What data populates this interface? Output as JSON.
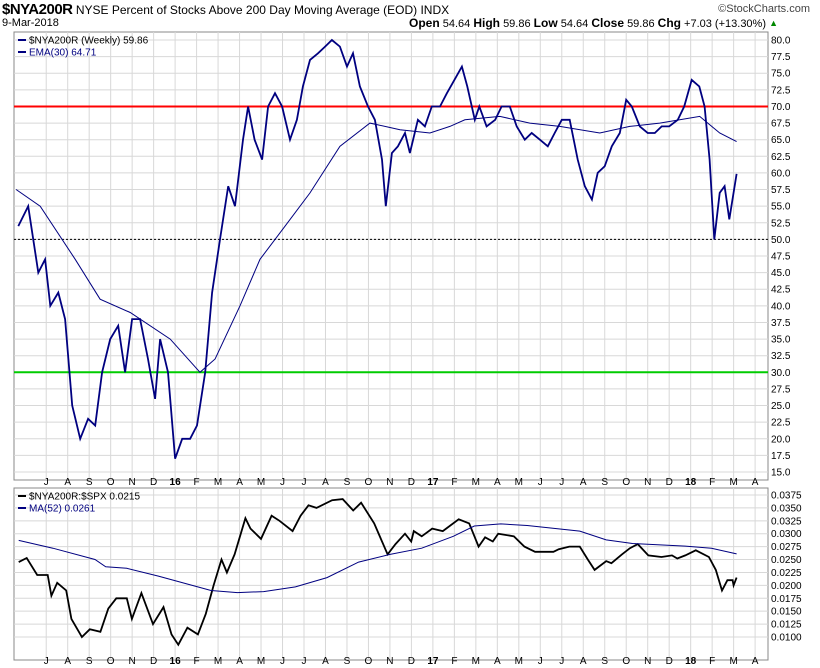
{
  "header": {
    "symbol": "$NYA200R",
    "description": "NYSE Percent of Stocks Above 200 Day Moving Average (EOD)",
    "exchange": "INDX",
    "brand": "©StockCharts.com",
    "date": "9-Mar-2018",
    "open_label": "Open",
    "open": "54.64",
    "high_label": "High",
    "high": "59.86",
    "low_label": "Low",
    "low": "54.64",
    "close_label": "Close",
    "close": "59.86",
    "chg_label": "Chg",
    "chg": "+7.03 (+13.30%)",
    "chg_icon": "up-triangle-icon"
  },
  "colors": {
    "price": "#000080",
    "ema": "#000080",
    "ratio": "#000000",
    "ma": "#000080",
    "red_line": "#ff0000",
    "green_line": "#00cc00",
    "grid": "#d8d8d8"
  },
  "chart_data": [
    {
      "type": "line",
      "title": "$NYA200R NYSE Percent of Stocks Above 200 Day Moving Average (EOD)",
      "x_unit": "months since Jun 2015",
      "xlim": [
        -0.5,
        34.6
      ],
      "ylim": [
        15,
        80
      ],
      "yticks": [
        15.0,
        17.5,
        20.0,
        22.5,
        25.0,
        27.5,
        30.0,
        32.5,
        35.0,
        37.5,
        40.0,
        42.5,
        45.0,
        47.5,
        50.0,
        52.5,
        55.0,
        57.5,
        60.0,
        62.5,
        65.0,
        67.5,
        70.0,
        72.5,
        75.0,
        77.5,
        80.0
      ],
      "xtick_labels": [
        "J",
        "A",
        "S",
        "O",
        "N",
        "D",
        "16",
        "F",
        "M",
        "A",
        "M",
        "J",
        "J",
        "A",
        "S",
        "O",
        "N",
        "D",
        "17",
        "F",
        "M",
        "A",
        "M",
        "J",
        "J",
        "A",
        "S",
        "O",
        "N",
        "D",
        "18",
        "F",
        "M",
        "A"
      ],
      "grid": true,
      "legend": "top-left",
      "hlines": [
        {
          "value": 70,
          "color": "#ff0000"
        },
        {
          "value": 30,
          "color": "#00cc00"
        },
        {
          "value": 50,
          "style": "dotted"
        }
      ],
      "series": [
        {
          "name": "$NYA200R (Weekly) 59.86",
          "key": "price",
          "x": [
            -0.3,
            0.16,
            0.63,
            0.95,
            1.19,
            1.56,
            1.88,
            2.21,
            2.58,
            2.95,
            3.28,
            3.6,
            3.98,
            4.35,
            4.67,
            5.0,
            5.37,
            5.74,
            6.07,
            6.3,
            6.67,
            7.0,
            7.33,
            7.7,
            8.02,
            8.4,
            8.72,
            9.09,
            9.47,
            9.79,
            10.16,
            10.4,
            10.7,
            11.05,
            11.33,
            11.65,
            11.98,
            12.35,
            12.67,
            12.95,
            13.28,
            13.65,
            13.98,
            14.3,
            14.67,
            15.0,
            15.28,
            15.6,
            15.98,
            16.3,
            16.63,
            16.81,
            17.09,
            17.37,
            17.7,
            17.93,
            18.3,
            18.63,
            18.95,
            19.33,
            19.65,
            20.0,
            20.35,
            20.6,
            20.95,
            21.16,
            21.5,
            21.9,
            22.2,
            22.58,
            22.9,
            23.28,
            23.6,
            23.98,
            24.35,
            24.67,
            25.0,
            25.37,
            25.74,
            26.07,
            26.4,
            26.67,
            27.0,
            27.33,
            27.7,
            28.0,
            28.26,
            28.63,
            29.0,
            29.33,
            29.65,
            30.0,
            30.4,
            30.7,
            31.05,
            31.4,
            31.65,
            31.88,
            32.1,
            32.35,
            32.58,
            32.8,
            33.14
          ],
          "y": [
            52,
            55,
            45,
            47,
            40,
            42,
            38,
            25,
            20,
            23,
            22,
            30,
            35,
            37,
            30,
            38,
            38,
            32,
            26,
            35,
            30,
            17,
            20,
            20,
            22,
            30,
            42,
            50,
            58,
            55,
            65,
            70,
            65,
            62,
            70,
            72,
            70,
            65,
            68,
            73,
            77,
            78,
            79,
            80,
            79,
            76,
            78,
            73,
            70,
            68,
            62,
            55,
            63,
            64,
            66,
            63,
            68,
            67,
            70,
            70,
            72,
            74,
            76,
            73,
            68,
            70,
            67,
            68,
            70,
            70,
            67,
            65,
            66,
            65,
            64,
            66,
            68,
            68,
            62,
            58,
            56,
            60,
            61,
            64,
            66,
            71,
            70,
            67,
            66,
            66,
            67,
            67,
            68,
            70,
            74,
            73,
            70,
            62,
            50,
            57,
            58,
            53,
            59.86
          ]
        },
        {
          "name": "EMA(30) 64.71",
          "key": "ema",
          "x": [
            -0.4,
            0.72,
            2.35,
            3.51,
            4.91,
            6.77,
            8.16,
            8.86,
            10.02,
            10.95,
            12.12,
            13.28,
            14.67,
            16.07,
            17.47,
            18.86,
            19.79,
            20.49,
            22.12,
            23.51,
            24.91,
            26.77,
            28.16,
            29.56,
            31.42,
            32.35,
            33.14
          ],
          "y": [
            57.5,
            55,
            47,
            41,
            39,
            35,
            30,
            32,
            40,
            47,
            52,
            57,
            64,
            67.5,
            66.5,
            66,
            67,
            68,
            68.5,
            67.5,
            67,
            66,
            67,
            67.5,
            68.5,
            66,
            64.71
          ]
        }
      ]
    },
    {
      "type": "line",
      "title": "$NYA200R:$SPX",
      "x_unit": "months since Jun 2015",
      "xlim": [
        -0.5,
        34.6
      ],
      "ylim": [
        0.0085,
        0.038
      ],
      "yticks": [
        "0.0100",
        "0.0125",
        "0.0150",
        "0.0175",
        "0.0200",
        "0.0225",
        "0.0250",
        "0.0275",
        "0.0300",
        "0.0325",
        "0.0350",
        "0.0375"
      ],
      "grid": true,
      "legend": "top-left",
      "series": [
        {
          "name": "$NYA200R:$SPX 0.0215",
          "key": "ratio",
          "x": [
            -0.28,
            0.09,
            0.58,
            1.07,
            1.24,
            1.51,
            1.93,
            2.17,
            2.66,
            3.03,
            3.52,
            3.89,
            4.26,
            4.75,
            4.99,
            5.43,
            5.97,
            6.46,
            6.83,
            7.15,
            7.57,
            8.06,
            8.43,
            8.79,
            9.16,
            9.41,
            9.77,
            10.27,
            10.51,
            11.0,
            11.49,
            11.86,
            12.47,
            12.84,
            13.21,
            13.58,
            14.31,
            14.8,
            15.29,
            15.66,
            16.27,
            16.89,
            17.26,
            17.7,
            17.99,
            18.11,
            18.48,
            18.97,
            19.46,
            20.2,
            20.69,
            21.13,
            21.43,
            21.79,
            22.04,
            22.77,
            23.26,
            23.76,
            24.61,
            24.86,
            25.35,
            25.84,
            26.21,
            26.53,
            27.07,
            27.31,
            27.8,
            28.17,
            28.54,
            29.03,
            29.64,
            30.13,
            30.38,
            30.75,
            31.24,
            31.85,
            32.17,
            32.46,
            32.71,
            32.95,
            33.0,
            33.14
          ],
          "y": [
            0.0245,
            0.0253,
            0.022,
            0.022,
            0.018,
            0.0205,
            0.019,
            0.0135,
            0.01,
            0.0115,
            0.011,
            0.0155,
            0.0175,
            0.0175,
            0.0135,
            0.0185,
            0.0125,
            0.0158,
            0.0105,
            0.0085,
            0.0118,
            0.0105,
            0.0145,
            0.02,
            0.025,
            0.0225,
            0.026,
            0.033,
            0.031,
            0.029,
            0.0335,
            0.0325,
            0.0305,
            0.0335,
            0.0355,
            0.035,
            0.0365,
            0.0367,
            0.0345,
            0.036,
            0.032,
            0.026,
            0.028,
            0.03,
            0.0285,
            0.0305,
            0.0295,
            0.031,
            0.0305,
            0.0328,
            0.032,
            0.0275,
            0.0293,
            0.0285,
            0.03,
            0.0295,
            0.0275,
            0.0265,
            0.0265,
            0.027,
            0.0275,
            0.0275,
            0.025,
            0.023,
            0.0247,
            0.0243,
            0.026,
            0.0272,
            0.028,
            0.0258,
            0.0255,
            0.0258,
            0.0252,
            0.0258,
            0.0268,
            0.0255,
            0.023,
            0.019,
            0.021,
            0.021,
            0.02,
            0.0215
          ]
        },
        {
          "name": "MA(52) 0.0261",
          "key": "ma",
          "x": [
            -0.28,
            1.31,
            3.27,
            3.77,
            4.75,
            6.22,
            8.67,
            9.9,
            11.12,
            12.6,
            14.07,
            15.54,
            17.01,
            18.48,
            19.95,
            20.93,
            22.16,
            23.39,
            25.84,
            27.07,
            28.29,
            30.75,
            31.97,
            33.14
          ],
          "y": [
            0.0287,
            0.0272,
            0.025,
            0.0236,
            0.0233,
            0.0218,
            0.019,
            0.0186,
            0.0188,
            0.0197,
            0.0215,
            0.0245,
            0.026,
            0.0272,
            0.0295,
            0.0315,
            0.0319,
            0.0316,
            0.0305,
            0.0288,
            0.0281,
            0.0276,
            0.0272,
            0.0261
          ]
        }
      ]
    }
  ]
}
